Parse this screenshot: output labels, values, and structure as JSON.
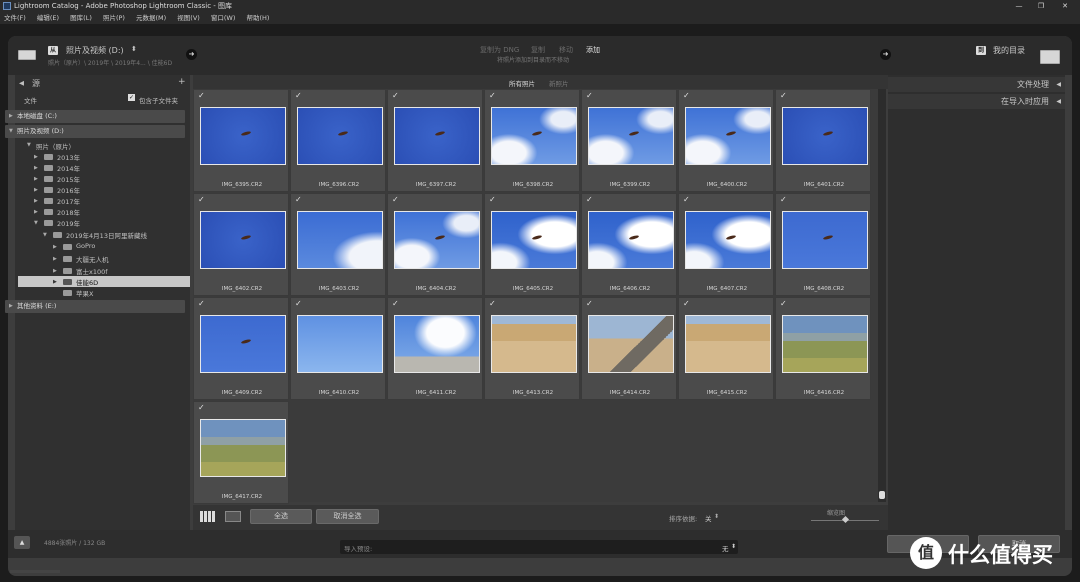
{
  "titlebar": {
    "title": "Lightroom Catalog - Adobe Photoshop Lightroom Classic - 图库"
  },
  "menu": [
    "文件(F)",
    "编辑(E)",
    "图库(L)",
    "照片(P)",
    "元数据(M)",
    "视图(V)",
    "窗口(W)",
    "帮助(H)"
  ],
  "header": {
    "source_tag": "从",
    "source_name": "照片及视频 (D:)",
    "source_path": "照片（原片）\\ 2019年 \\ 2019年4... \\ 佳能6D",
    "dest_tag": "到",
    "dest_name": "我的目录",
    "modes": [
      "复制为 DNG",
      "复制",
      "移动",
      "添加"
    ],
    "mode_hint": "将照片添加到目录而不移动"
  },
  "left": {
    "title": "源",
    "files_label": "文件",
    "include_sub": "包含子文件夹",
    "drive_c": "本地磁盘 (C:)",
    "drive_d": "照片及视频 (D:)",
    "root_folder": "照片（原片）",
    "years": [
      "2013年",
      "2014年",
      "2015年",
      "2016年",
      "2017年",
      "2018年",
      "2019年"
    ],
    "event_folder": "2019年4月13日阿里新藏线",
    "subfolders": [
      "GoPro",
      "大疆无人机",
      "富士x100f",
      "佳能6D",
      "苹果X"
    ],
    "drive_e": "其他资料 (E:)"
  },
  "tabs": {
    "all": "所有照片",
    "new": "新照片"
  },
  "photos": [
    {
      "name": "IMG_6395.CR2",
      "kind": "sky"
    },
    {
      "name": "IMG_6396.CR2",
      "kind": "sky"
    },
    {
      "name": "IMG_6397.CR2",
      "kind": "sky"
    },
    {
      "name": "IMG_6398.CR2",
      "kind": "cloud"
    },
    {
      "name": "IMG_6399.CR2",
      "kind": "cloud"
    },
    {
      "name": "IMG_6400.CR2",
      "kind": "cloud"
    },
    {
      "name": "IMG_6401.CR2",
      "kind": "sky"
    },
    {
      "name": "IMG_6402.CR2",
      "kind": "sky"
    },
    {
      "name": "IMG_6403.CR2",
      "kind": "cloudcorner"
    },
    {
      "name": "IMG_6404.CR2",
      "kind": "cloud"
    },
    {
      "name": "IMG_6405.CR2",
      "kind": "cloudbig"
    },
    {
      "name": "IMG_6406.CR2",
      "kind": "cloudbig"
    },
    {
      "name": "IMG_6407.CR2",
      "kind": "cloudbig"
    },
    {
      "name": "IMG_6408.CR2",
      "kind": "skyplain"
    },
    {
      "name": "IMG_6409.CR2",
      "kind": "skyplain"
    },
    {
      "name": "IMG_6410.CR2",
      "kind": "skylight"
    },
    {
      "name": "IMG_6411.CR2",
      "kind": "cloudland"
    },
    {
      "name": "IMG_6413.CR2",
      "kind": "steppe"
    },
    {
      "name": "IMG_6414.CR2",
      "kind": "mountain"
    },
    {
      "name": "IMG_6415.CR2",
      "kind": "steppe"
    },
    {
      "name": "IMG_6416.CR2",
      "kind": "grass"
    },
    {
      "name": "IMG_6417.CR2",
      "kind": "grass"
    }
  ],
  "toolbar": {
    "select_all": "全选",
    "deselect_all": "取消全选",
    "sort_label": "排序依据:",
    "sort_value": "关",
    "thumb_label": "缩览图"
  },
  "right": {
    "file_handling": "文件处理",
    "apply_on_import": "在导入时应用"
  },
  "bottom": {
    "count": "4884张照片 / 132 GB",
    "preset_label": "导入预设:",
    "preset_value": "无",
    "cancel": "取消"
  },
  "watermark": {
    "text": "什么值得买",
    "logo": "值"
  }
}
